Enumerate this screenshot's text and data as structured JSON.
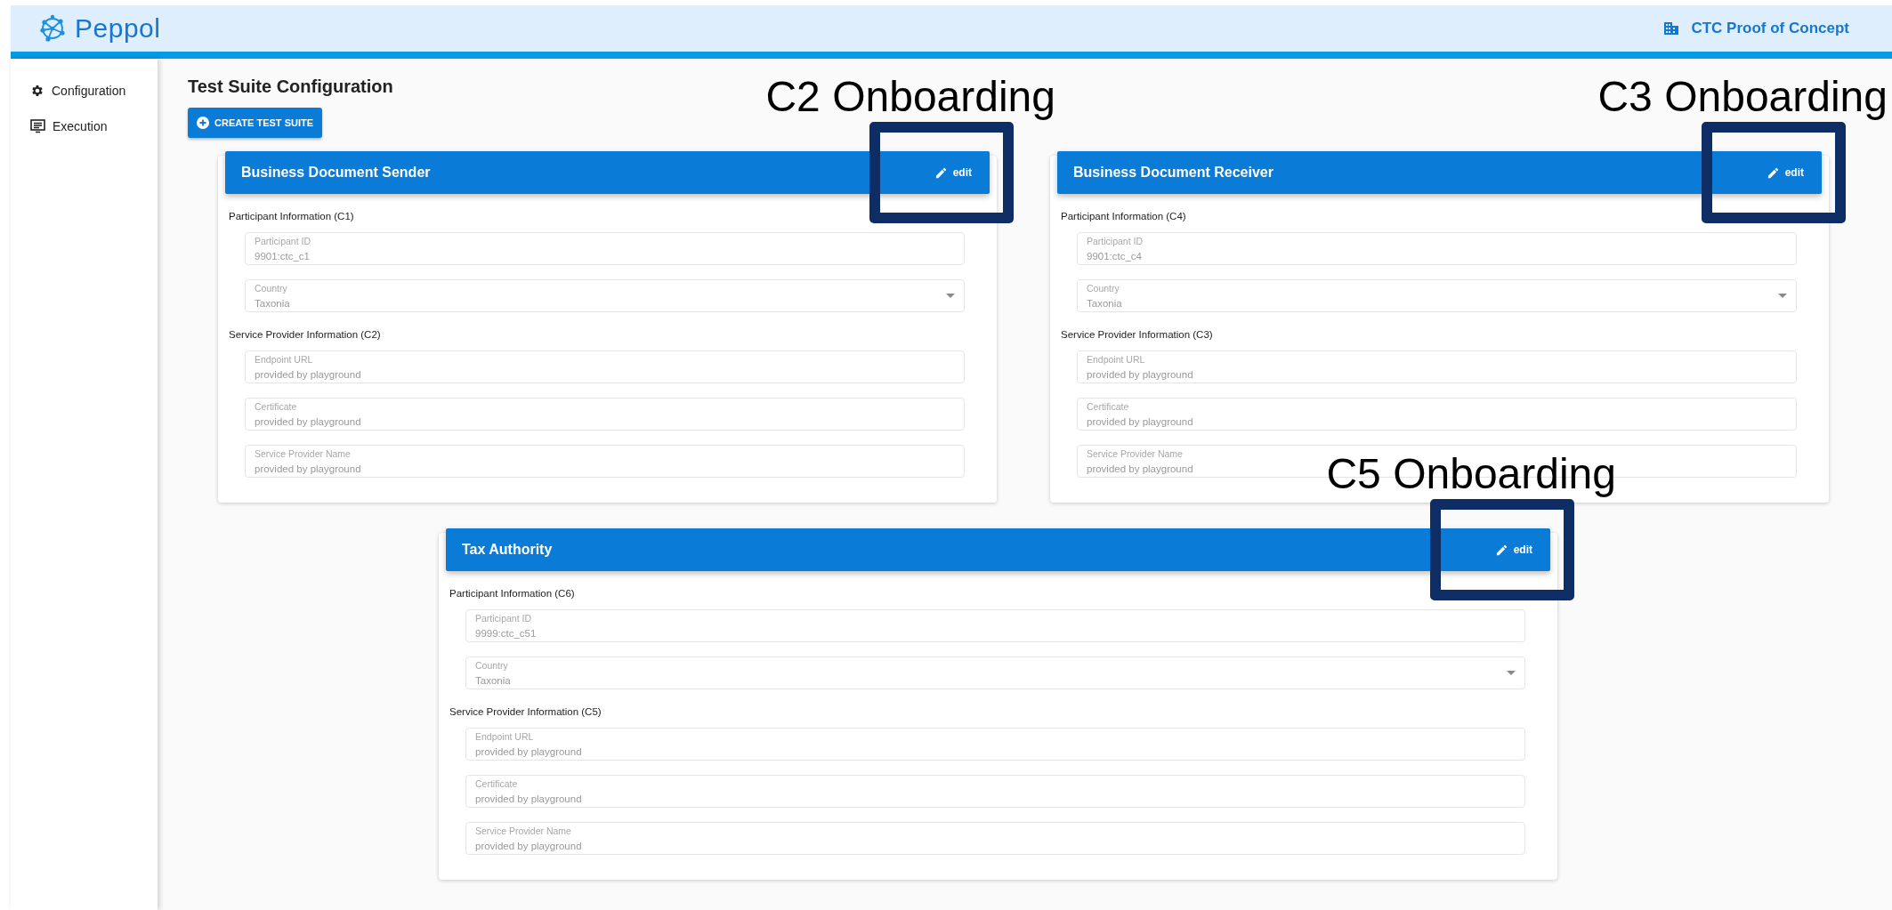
{
  "header": {
    "brand": "Peppol",
    "project": "CTC Proof of Concept"
  },
  "sidebar": {
    "items": [
      {
        "label": "Configuration",
        "kind": "gear"
      },
      {
        "label": "Execution",
        "kind": "monitor"
      }
    ]
  },
  "page_title": "Test Suite Configuration",
  "create_button": "CREATE TEST SUITE",
  "cards": [
    {
      "title": "Business Document Sender",
      "edit_label": "edit",
      "annotation": "C2 Onboarding",
      "sections": [
        {
          "heading": "Participant Information (C1)",
          "fields": [
            {
              "kind": "text",
              "label": "Participant ID",
              "value": "9901:ctc_c1"
            },
            {
              "kind": "select",
              "label": "Country",
              "value": "Taxonia"
            }
          ]
        },
        {
          "heading": "Service Provider Information (C2)",
          "fields": [
            {
              "kind": "text",
              "label": "Endpoint URL",
              "value": "provided by playground"
            },
            {
              "kind": "text",
              "label": "Certificate",
              "value": "provided by playground"
            },
            {
              "kind": "text",
              "label": "Service Provider Name",
              "value": "provided by playground"
            }
          ]
        }
      ]
    },
    {
      "title": "Business Document Receiver",
      "edit_label": "edit",
      "annotation": "C3 Onboarding",
      "sections": [
        {
          "heading": "Participant Information (C4)",
          "fields": [
            {
              "kind": "text",
              "label": "Participant ID",
              "value": "9901:ctc_c4"
            },
            {
              "kind": "select",
              "label": "Country",
              "value": "Taxonia"
            }
          ]
        },
        {
          "heading": "Service Provider Information (C3)",
          "fields": [
            {
              "kind": "text",
              "label": "Endpoint URL",
              "value": "provided by playground"
            },
            {
              "kind": "text",
              "label": "Certificate",
              "value": "provided by playground"
            },
            {
              "kind": "text",
              "label": "Service Provider Name",
              "value": "provided by playground"
            }
          ]
        }
      ]
    },
    {
      "title": "Tax Authority",
      "edit_label": "edit",
      "annotation": "C5 Onboarding",
      "sections": [
        {
          "heading": "Participant Information (C6)",
          "fields": [
            {
              "kind": "text",
              "label": "Participant ID",
              "value": "9999:ctc_c51"
            },
            {
              "kind": "select",
              "label": "Country",
              "value": "Taxonia"
            }
          ]
        },
        {
          "heading": "Service Provider Information (C5)",
          "fields": [
            {
              "kind": "text",
              "label": "Endpoint URL",
              "value": "provided by playground"
            },
            {
              "kind": "text",
              "label": "Certificate",
              "value": "provided by playground"
            },
            {
              "kind": "text",
              "label": "Service Provider Name",
              "value": "provided by playground"
            }
          ]
        }
      ]
    }
  ]
}
